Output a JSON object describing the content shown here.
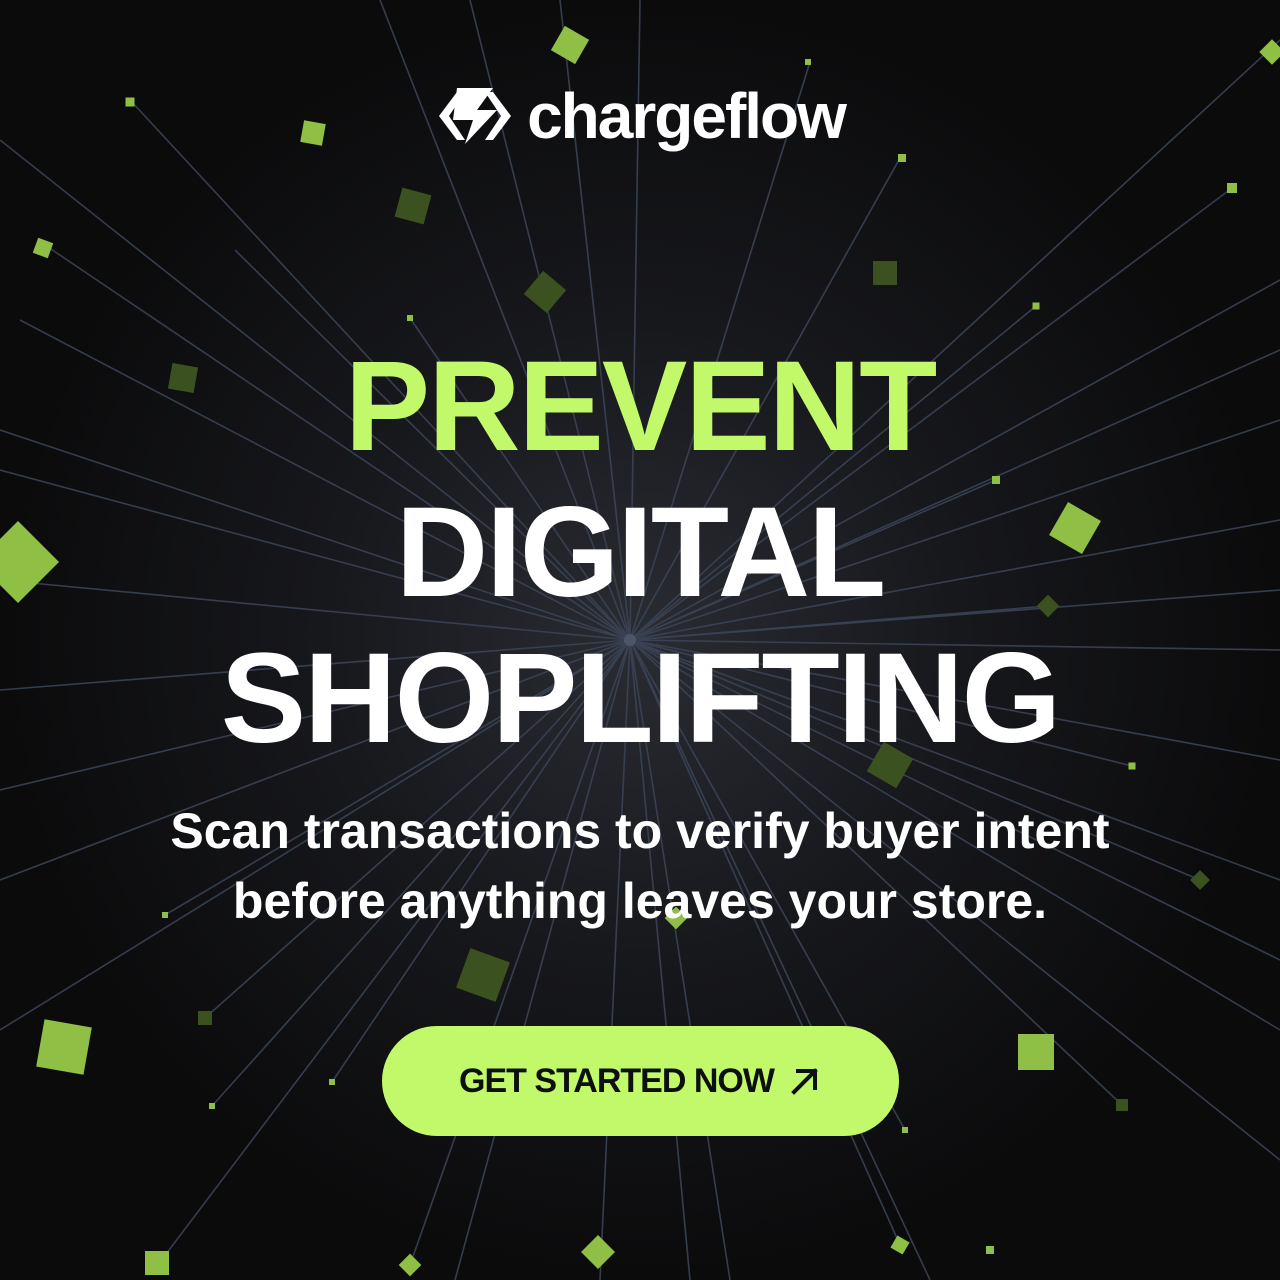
{
  "brand": {
    "name": "chargeflow",
    "logo_icon": "chargeflow-logo-icon"
  },
  "headline": {
    "line1": "PREVENT",
    "line2": "DIGITAL",
    "line3": "SHOPLIFTING"
  },
  "subtitle": {
    "line1": "Scan transactions to verify buyer intent",
    "line2": "before anything leaves your store."
  },
  "cta": {
    "label": "GET STARTED NOW",
    "icon": "arrow-up-right-icon"
  },
  "colors": {
    "accent": "#c2f96a",
    "background": "#0b0b0c",
    "text": "#ffffff",
    "cta_text": "#0e0f10",
    "square_bright": "#8fbf45",
    "square_dark": "#3b5220",
    "ray": "#3a4355"
  }
}
